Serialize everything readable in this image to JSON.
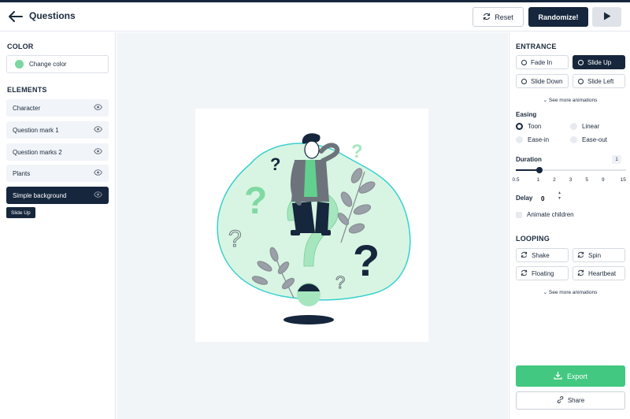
{
  "header": {
    "title": "Questions",
    "reset_label": "Reset",
    "randomize_label": "Randomize!"
  },
  "left": {
    "color_title": "COLOR",
    "change_color_label": "Change color",
    "swatch_color": "#7bd7a0",
    "elements_title": "ELEMENTS",
    "elements": [
      {
        "label": "Character",
        "active": false
      },
      {
        "label": "Question mark 1",
        "active": false
      },
      {
        "label": "Question marks 2",
        "active": false
      },
      {
        "label": "Plants",
        "active": false
      },
      {
        "label": "Simple background",
        "active": true
      }
    ],
    "selected_tag": "Slide Up"
  },
  "right": {
    "entrance_title": "ENTRANCE",
    "entrance": [
      {
        "label": "Fade In",
        "active": false
      },
      {
        "label": "Slide Up",
        "active": true
      },
      {
        "label": "Slide Down",
        "active": false
      },
      {
        "label": "Slide Left",
        "active": false
      }
    ],
    "more_label": "See more animations",
    "easing_label": "Easing",
    "easing": [
      {
        "label": "Toon",
        "selected": true
      },
      {
        "label": "Linear",
        "selected": false
      },
      {
        "label": "Ease-in",
        "selected": false
      },
      {
        "label": "Ease-out",
        "selected": false
      }
    ],
    "duration_label": "Duration",
    "duration_value": "1",
    "duration_ticks": [
      "0.5",
      "1",
      "2",
      "3",
      "5",
      "9",
      "15"
    ],
    "delay_label": "Delay",
    "delay_value": "0",
    "animate_children_label": "Animate children",
    "looping_title": "LOOPING",
    "looping": [
      {
        "label": "Shake"
      },
      {
        "label": "Spin"
      },
      {
        "label": "Floating"
      },
      {
        "label": "Heartbeat"
      }
    ],
    "export_label": "Export",
    "share_label": "Share"
  },
  "colors": {
    "navy": "#16263c",
    "accent_green": "#42c880",
    "blob_green": "#d8f5e3",
    "blob_outline": "#39d0d0"
  }
}
